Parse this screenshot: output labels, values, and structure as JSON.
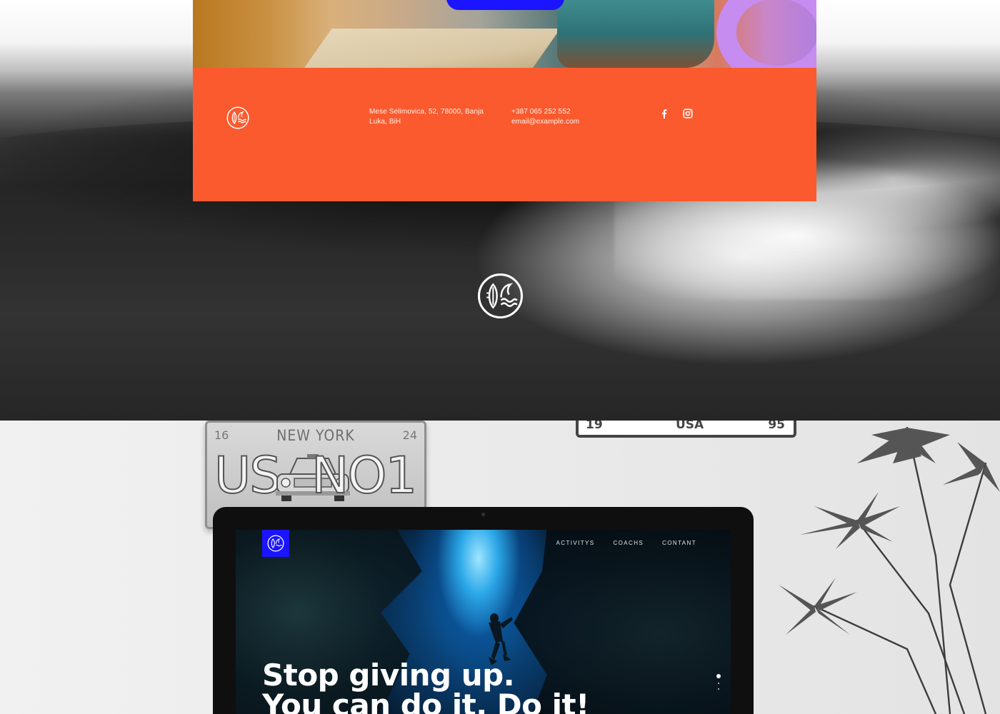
{
  "hero": {
    "logo_icon": "surf-waves-logo-icon",
    "slider_dots": 1
  },
  "footer": {
    "background_color": "#fb5a2e",
    "logo_icon": "surf-waves-logo-icon",
    "address_line1": "Mese Selimovica, 52, 78000, Banja",
    "address_line2": "Luka, BiH",
    "phone": "+387 065 252 552",
    "email": "email@example.com",
    "social": [
      {
        "icon": "facebook-icon"
      },
      {
        "icon": "instagram-icon"
      }
    ]
  },
  "cta": {
    "color": "#1a14ff"
  },
  "mockup": {
    "plate_left": {
      "top_left": "16",
      "top_title": "NEW YORK",
      "top_right": "24",
      "big_left": "US",
      "big_right": "NO1"
    },
    "plate_right": {
      "left": "19",
      "center": "USA",
      "right": "95"
    },
    "screen": {
      "brand_color": "#1a14ff",
      "nav": [
        "ACTIVITYS",
        "COACHS",
        "CONTANT"
      ],
      "headline_line1": "Stop giving up.",
      "headline_line2": "You can do it. Do it!"
    }
  }
}
